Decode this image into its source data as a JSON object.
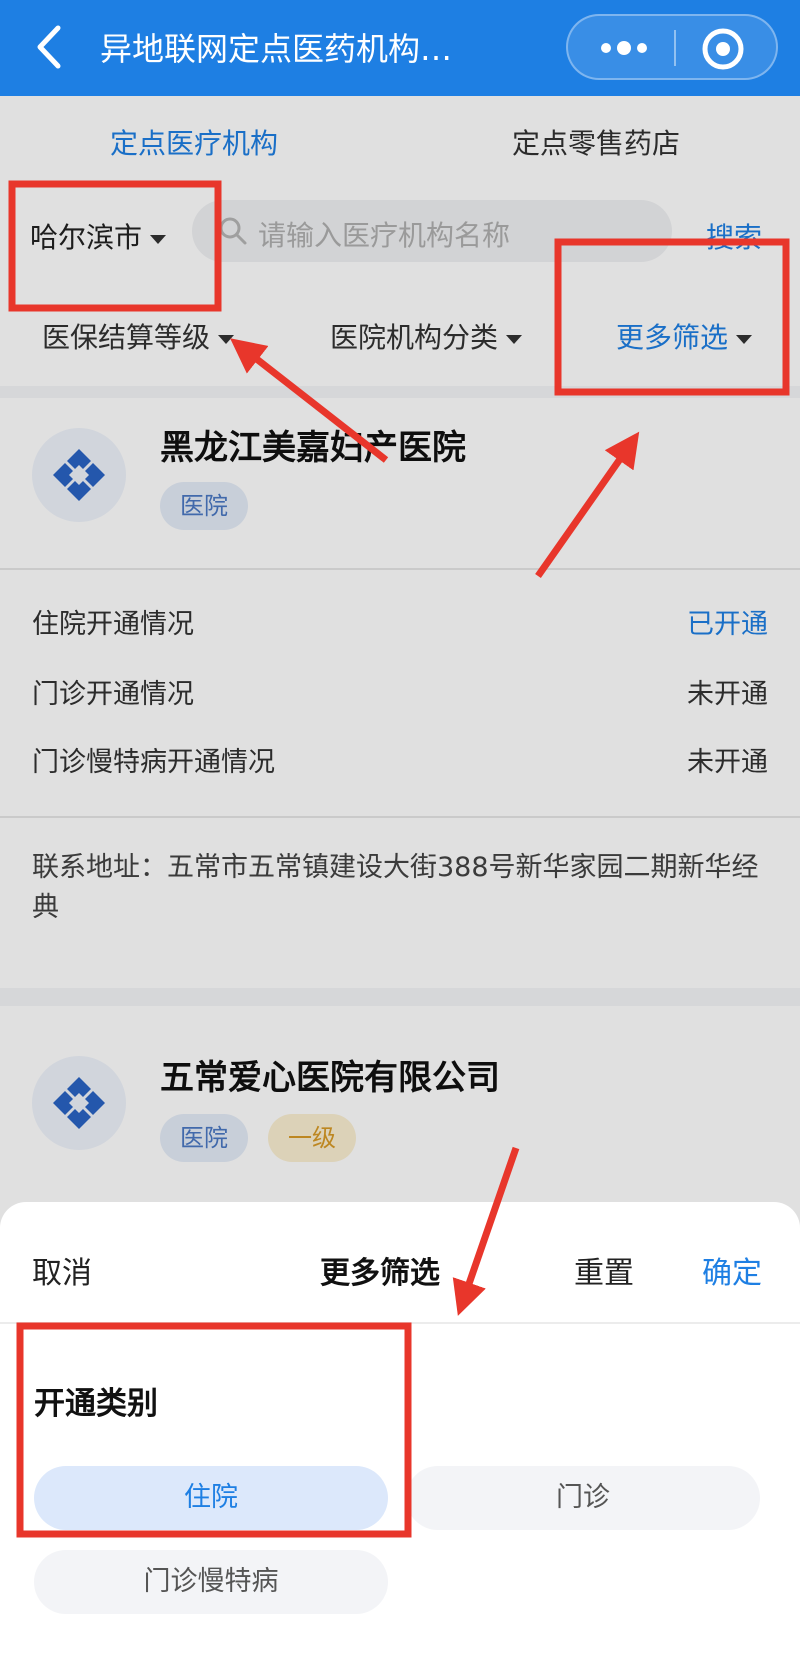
{
  "header": {
    "title": "异地联网定点医药机构…",
    "back_icon": "chevron-left-icon",
    "more_icon": "more-dots-icon",
    "close_icon": "target-icon"
  },
  "tabs": [
    {
      "label": "定点医疗机构",
      "active": true
    },
    {
      "label": "定点零售药店",
      "active": false
    }
  ],
  "search": {
    "city": "哈尔滨市",
    "placeholder": "请输入医疗机构名称",
    "button": "搜索"
  },
  "filters": [
    {
      "label": "医保结算等级"
    },
    {
      "label": "医院机构分类"
    },
    {
      "label": "更多筛选",
      "active": true
    }
  ],
  "hospitals": [
    {
      "name": "黑龙江美嘉妇产医院",
      "tags": [
        "医院"
      ],
      "status": [
        {
          "label": "住院开通情况",
          "value": "已开通"
        },
        {
          "label": "门诊开通情况",
          "value": "未开通"
        },
        {
          "label": "门诊慢特病开通情况",
          "value": "未开通"
        }
      ],
      "address": "联系地址：五常市五常镇建设大街388号新华家园二期新华经典"
    },
    {
      "name": "五常爱心医院有限公司",
      "tags": [
        "医院",
        "一级"
      ]
    }
  ],
  "sheet": {
    "cancel": "取消",
    "title": "更多筛选",
    "reset": "重置",
    "confirm": "确定",
    "section_title": "开通类别",
    "options": [
      {
        "label": "住院",
        "selected": true
      },
      {
        "label": "门诊",
        "selected": false
      },
      {
        "label": "门诊慢特病",
        "selected": false
      }
    ]
  },
  "colors": {
    "accent": "#1e7fe3",
    "annotation": "#e8362b"
  }
}
